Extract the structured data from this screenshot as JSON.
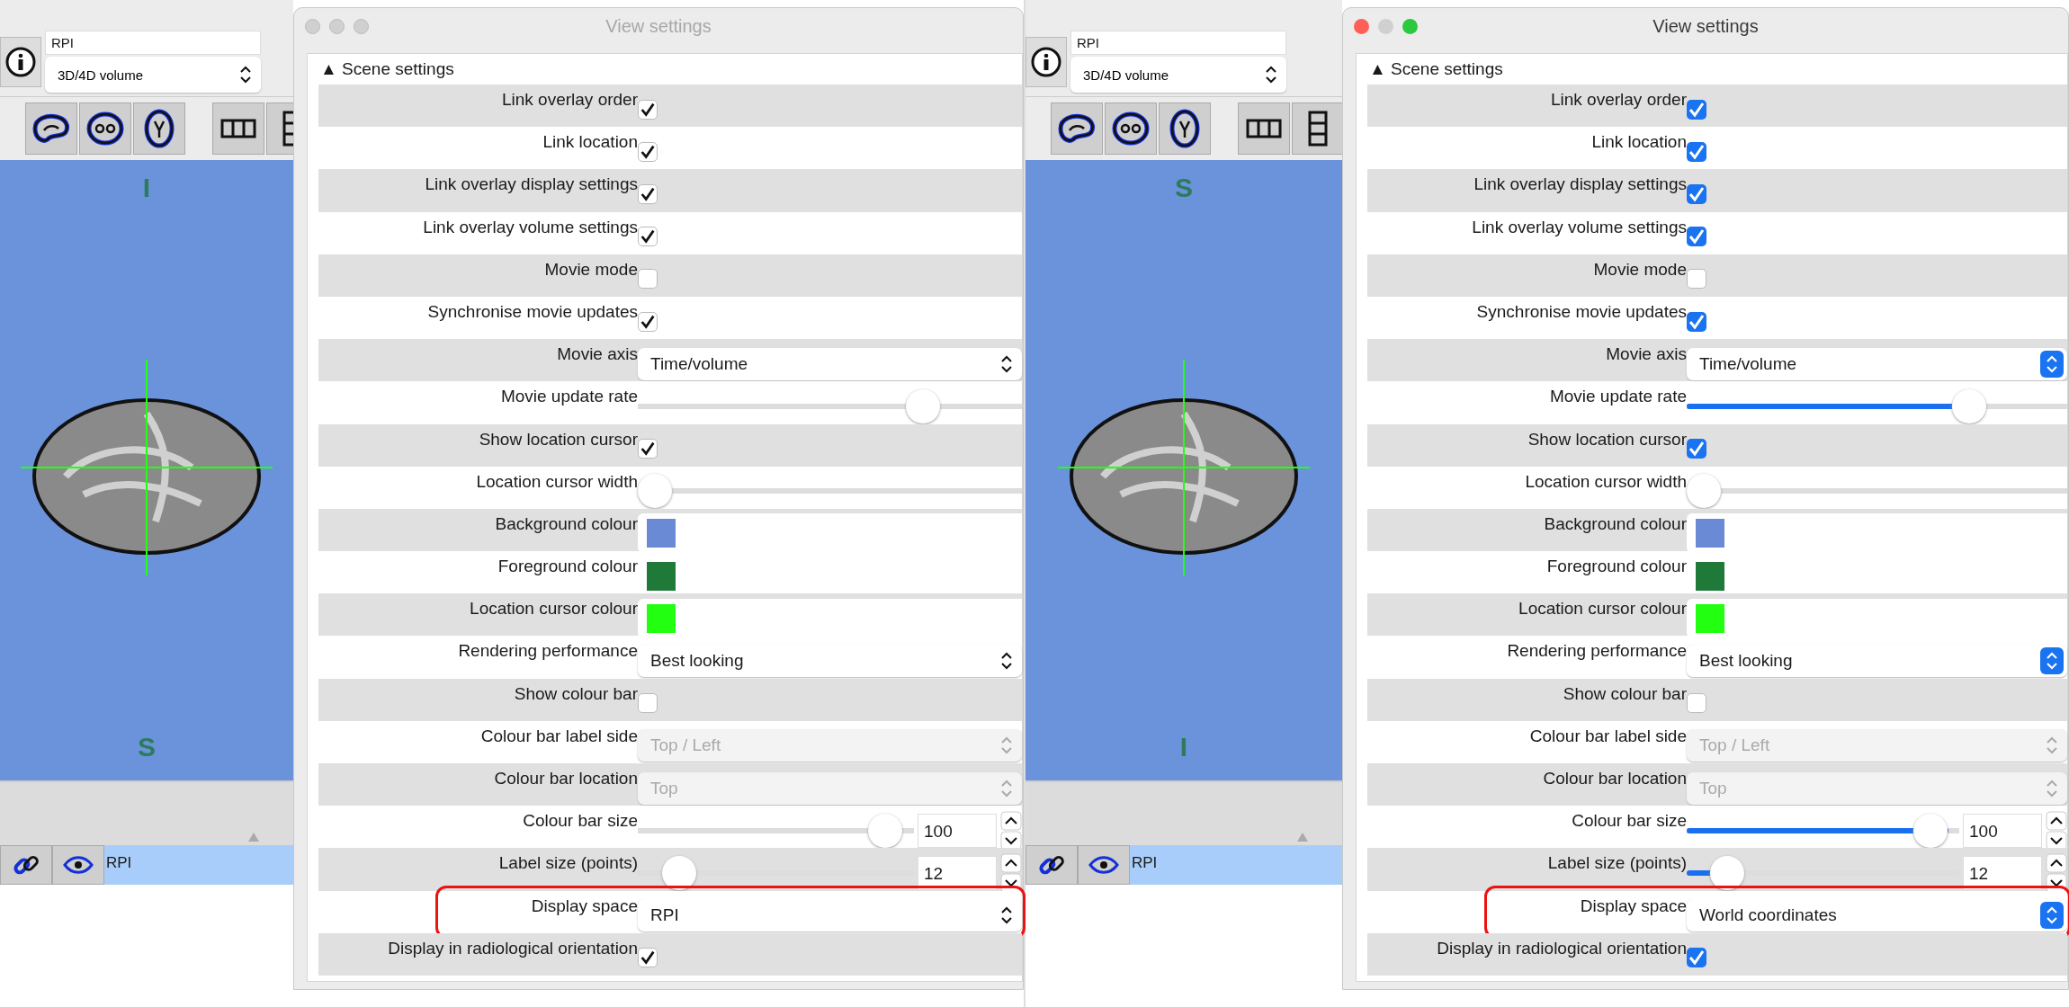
{
  "panels": [
    {
      "active": false,
      "viewer": {
        "info_field": "RPI",
        "overlay_type": "3D/4D volume",
        "top_label": "I",
        "bottom_label": "S",
        "list_item": "RPI"
      },
      "dialog": {
        "title": "View settings",
        "section": "▲ Scene settings",
        "rows": [
          {
            "kind": "checkbox",
            "label": "Link overlay order",
            "checked": true
          },
          {
            "kind": "checkbox",
            "label": "Link location",
            "checked": true
          },
          {
            "kind": "checkbox",
            "label": "Link overlay display settings",
            "checked": true
          },
          {
            "kind": "checkbox",
            "label": "Link overlay volume settings",
            "checked": true
          },
          {
            "kind": "checkbox",
            "label": "Movie mode",
            "checked": false
          },
          {
            "kind": "checkbox",
            "label": "Synchronise movie updates",
            "checked": true
          },
          {
            "kind": "dropdown",
            "label": "Movie axis",
            "value": "Time/volume",
            "disabled": false
          },
          {
            "kind": "slider",
            "label": "Movie update rate",
            "level": 0.77
          },
          {
            "kind": "checkbox",
            "label": "Show location cursor",
            "checked": true
          },
          {
            "kind": "slider",
            "label": "Location cursor width",
            "level": 0
          },
          {
            "kind": "colour",
            "label": "Background colour",
            "color": "#6a8ad6"
          },
          {
            "kind": "colour",
            "label": "Foreground colour",
            "color": "#1f7a3a"
          },
          {
            "kind": "colour",
            "label": "Location cursor colour",
            "color": "#22ff11"
          },
          {
            "kind": "dropdown",
            "label": "Rendering performance",
            "value": "Best looking",
            "disabled": false
          },
          {
            "kind": "checkbox",
            "label": "Show colour bar",
            "checked": false
          },
          {
            "kind": "dropdown",
            "label": "Colour bar label side",
            "value": "Top / Left",
            "disabled": true
          },
          {
            "kind": "dropdown",
            "label": "Colour bar location",
            "value": "Top",
            "disabled": true
          },
          {
            "kind": "spinslider",
            "label": "Colour bar size",
            "level": 0.96,
            "value": "100"
          },
          {
            "kind": "spinslider",
            "label": "Label size (points)",
            "level": 0.1,
            "value": "12"
          },
          {
            "kind": "dropdown",
            "label": "Display space",
            "value": "RPI",
            "disabled": false,
            "highlighted": true
          },
          {
            "kind": "checkbox",
            "label": "Display in radiological orientation",
            "checked": true
          }
        ]
      }
    },
    {
      "active": true,
      "viewer": {
        "info_field": "RPI",
        "overlay_type": "3D/4D volume",
        "top_label": "S",
        "bottom_label": "I",
        "list_item": "RPI"
      },
      "dialog": {
        "title": "View settings",
        "section": "▲ Scene settings",
        "rows": [
          {
            "kind": "checkbox",
            "label": "Link overlay order",
            "checked": true
          },
          {
            "kind": "checkbox",
            "label": "Link location",
            "checked": true
          },
          {
            "kind": "checkbox",
            "label": "Link overlay display settings",
            "checked": true
          },
          {
            "kind": "checkbox",
            "label": "Link overlay volume settings",
            "checked": true
          },
          {
            "kind": "checkbox",
            "label": "Movie mode",
            "checked": false
          },
          {
            "kind": "checkbox",
            "label": "Synchronise movie updates",
            "checked": true
          },
          {
            "kind": "dropdown",
            "label": "Movie axis",
            "value": "Time/volume",
            "disabled": false
          },
          {
            "kind": "slider",
            "label": "Movie update rate",
            "level": 0.77
          },
          {
            "kind": "checkbox",
            "label": "Show location cursor",
            "checked": true
          },
          {
            "kind": "slider",
            "label": "Location cursor width",
            "level": 0
          },
          {
            "kind": "colour",
            "label": "Background colour",
            "color": "#6a8ad6"
          },
          {
            "kind": "colour",
            "label": "Foreground colour",
            "color": "#1f7a3a"
          },
          {
            "kind": "colour",
            "label": "Location cursor colour",
            "color": "#22ff11"
          },
          {
            "kind": "dropdown",
            "label": "Rendering performance",
            "value": "Best looking",
            "disabled": false
          },
          {
            "kind": "checkbox",
            "label": "Show colour bar",
            "checked": false
          },
          {
            "kind": "dropdown",
            "label": "Colour bar label side",
            "value": "Top / Left",
            "disabled": true
          },
          {
            "kind": "dropdown",
            "label": "Colour bar location",
            "value": "Top",
            "disabled": true
          },
          {
            "kind": "spinslider",
            "label": "Colour bar size",
            "level": 0.96,
            "value": "100"
          },
          {
            "kind": "spinslider",
            "label": "Label size (points)",
            "level": 0.1,
            "value": "12"
          },
          {
            "kind": "dropdown",
            "label": "Display space",
            "value": "World coordinates",
            "disabled": false,
            "highlighted": true
          },
          {
            "kind": "checkbox",
            "label": "Display in radiological orientation",
            "checked": true
          }
        ]
      }
    }
  ]
}
